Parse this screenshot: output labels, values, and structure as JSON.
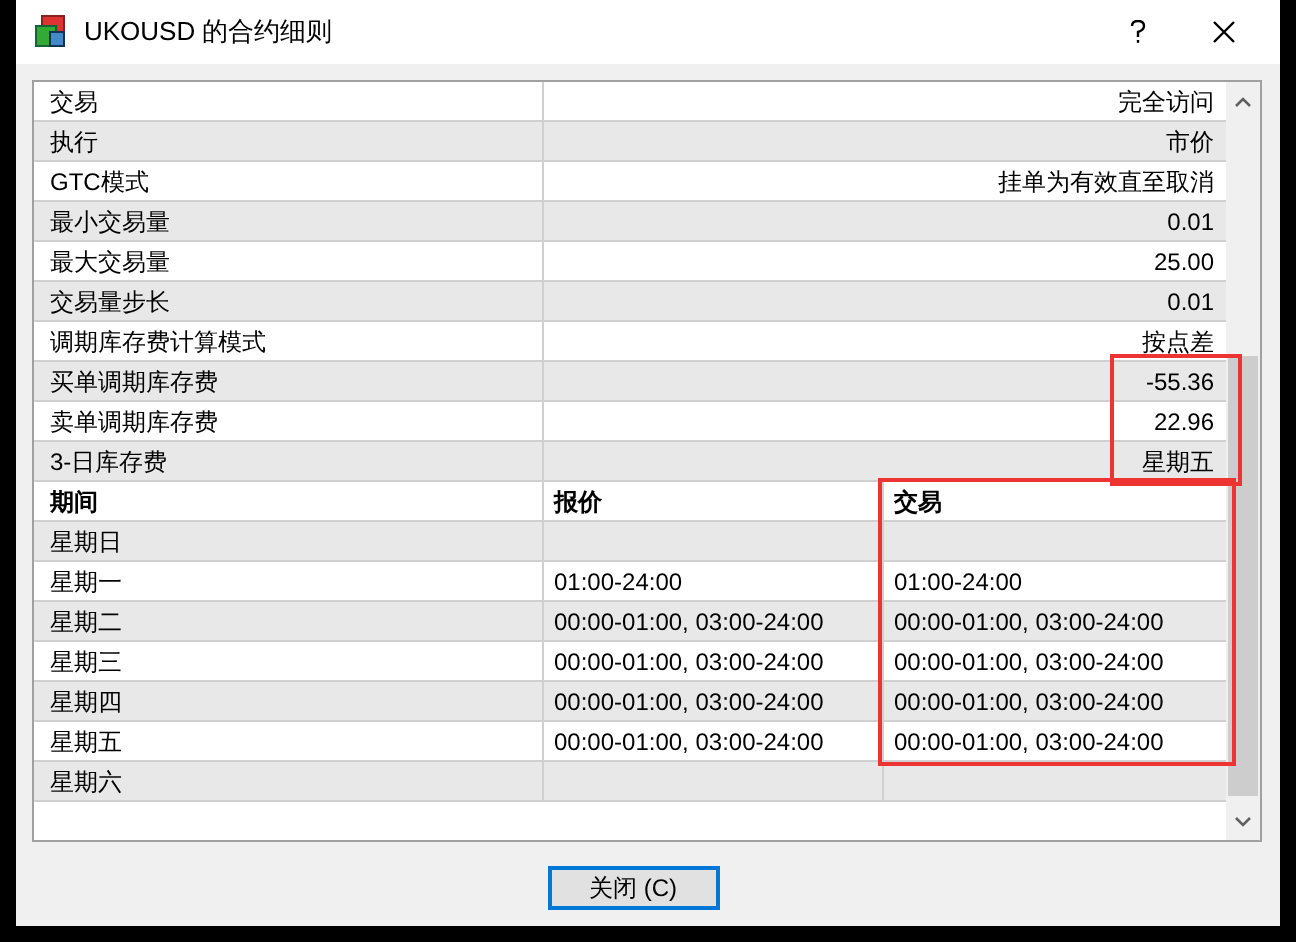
{
  "window": {
    "title": "UKOUSD 的合约细则"
  },
  "properties": [
    {
      "label": "交易",
      "value": "完全访问",
      "highlighted": false
    },
    {
      "label": "执行",
      "value": "市价",
      "highlighted": false
    },
    {
      "label": "GTC模式",
      "value": "挂单为有效直至取消",
      "highlighted": false
    },
    {
      "label": "最小交易量",
      "value": "0.01",
      "highlighted": false
    },
    {
      "label": "最大交易量",
      "value": "25.00",
      "highlighted": false
    },
    {
      "label": "交易量步长",
      "value": "0.01",
      "highlighted": false
    },
    {
      "label": "调期库存费计算模式",
      "value": "按点差",
      "highlighted": false
    },
    {
      "label": "买单调期库存费",
      "value": "-55.36",
      "highlighted": true
    },
    {
      "label": "卖单调期库存费",
      "value": "22.96",
      "highlighted": true
    },
    {
      "label": "3-日库存费",
      "value": "星期五",
      "highlighted": true
    }
  ],
  "schedule": {
    "columns": [
      {
        "label": "期间",
        "highlighted": false
      },
      {
        "label": "报价",
        "highlighted": false
      },
      {
        "label": "交易",
        "highlighted": true
      }
    ],
    "rows": [
      [
        "星期日",
        "",
        ""
      ],
      [
        "星期一",
        "01:00-24:00",
        "01:00-24:00"
      ],
      [
        "星期二",
        "00:00-01:00, 03:00-24:00",
        "00:00-01:00, 03:00-24:00"
      ],
      [
        "星期三",
        "00:00-01:00, 03:00-24:00",
        "00:00-01:00, 03:00-24:00"
      ],
      [
        "星期四",
        "00:00-01:00, 03:00-24:00",
        "00:00-01:00, 03:00-24:00"
      ],
      [
        "星期五",
        "00:00-01:00, 03:00-24:00",
        "00:00-01:00, 03:00-24:00"
      ],
      [
        "星期六",
        "",
        ""
      ]
    ]
  },
  "close_button": "关闭 (C)"
}
